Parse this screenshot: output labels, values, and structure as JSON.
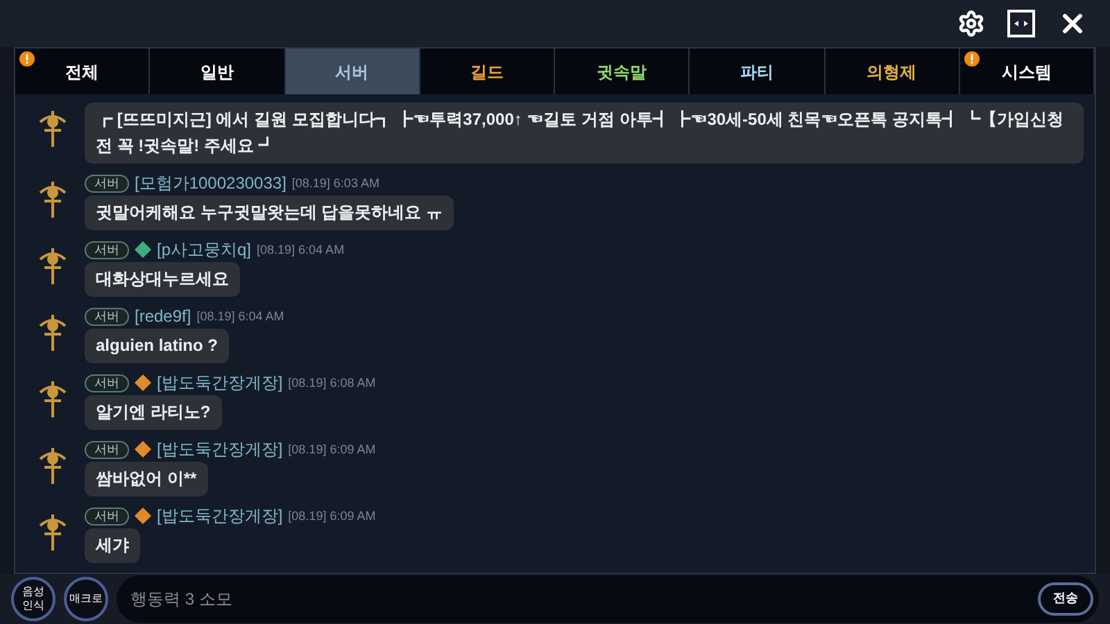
{
  "tabs": [
    {
      "label": "전체",
      "selected": false,
      "alert": true,
      "color": "#ffffff"
    },
    {
      "label": "일반",
      "selected": false,
      "alert": false,
      "color": "#ffffff"
    },
    {
      "label": "서버",
      "selected": true,
      "alert": false,
      "color": "#a9c6d8"
    },
    {
      "label": "길드",
      "selected": false,
      "alert": false,
      "color": "#f0a030"
    },
    {
      "label": "귓속말",
      "selected": false,
      "alert": false,
      "color": "#8fd86a"
    },
    {
      "label": "파티",
      "selected": false,
      "alert": false,
      "color": "#a8d8f0"
    },
    {
      "label": "의형제",
      "selected": false,
      "alert": false,
      "color": "#e0b040"
    },
    {
      "label": "시스템",
      "selected": false,
      "alert": true,
      "color": "#ffffff"
    }
  ],
  "messages": [
    {
      "text": "┏ [뜨뜨미지근] 에서 길원 모집합니다┓   ┣☜투력37,000↑ ☜길토 거점 아투┫   ┣☜30세-50세 친목☜오픈톡 공지톡┫   ┗【가입신청 전 꼭 !귓속말! 주세요   ┛"
    },
    {
      "channel": "서버",
      "name": "[모험가1000230033]",
      "time": "[08.19] 6:03 AM",
      "text": "귓말어케해요 누구귓말왓는데 답을못하네요 ㅠ"
    },
    {
      "channel": "서버",
      "color": "#3fae7f",
      "name": "[p사고뭉치q]",
      "time": "[08.19] 6:04 AM",
      "text": "대화상대누르세요"
    },
    {
      "channel": "서버",
      "name": "[rede9f]",
      "time": "[08.19] 6:04 AM",
      "text": "alguien latino ?"
    },
    {
      "channel": "서버",
      "color": "#e08a2a",
      "name": "[밥도둑간장게장]",
      "time": "[08.19] 6:08 AM",
      "text": "알기엔 라티노?"
    },
    {
      "channel": "서버",
      "color": "#e08a2a",
      "name": "[밥도둑간장게장]",
      "time": "[08.19] 6:09 AM",
      "text": "쌈바없어 이**"
    },
    {
      "channel": "서버",
      "color": "#e08a2a",
      "name": "[밥도둑간장게장]",
      "time": "[08.19] 6:09 AM",
      "text": "세갸"
    }
  ],
  "voice_button": {
    "line1": "음성",
    "line2": "인식"
  },
  "macro_button": "매크로",
  "input": {
    "placeholder": "행동력 3 소모"
  },
  "send_button": "전송"
}
